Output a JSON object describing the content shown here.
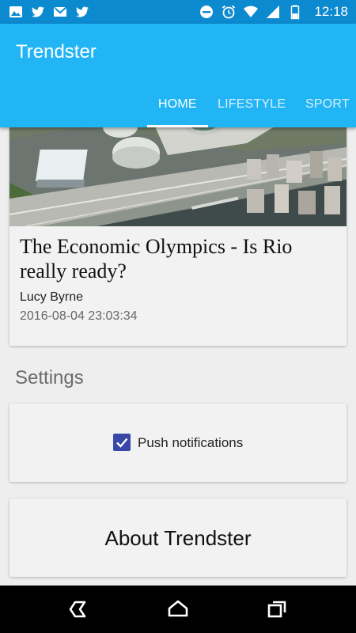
{
  "status_bar": {
    "time": "12:18",
    "left_icons": [
      "image-icon",
      "twitter-icon",
      "gmail-icon",
      "twitter-icon"
    ],
    "right_icons": [
      "do-not-disturb-icon",
      "alarm-icon",
      "wifi-icon",
      "signal-icon",
      "battery-icon"
    ]
  },
  "app_bar": {
    "title": "Trendster",
    "color": "#22b5f5",
    "tabs": [
      {
        "label": "HOME",
        "active": true
      },
      {
        "label": "LIFESTYLE",
        "active": false
      },
      {
        "label": "SPORT",
        "active": false
      }
    ]
  },
  "article": {
    "title": "The Economic Olympics - Is Rio really ready?",
    "author": "Lucy Byrne",
    "date": "2016-08-04 23:03:34",
    "image": "rio-olympic-park-aerial-photo"
  },
  "settings": {
    "heading": "Settings",
    "push_notifications": {
      "label": "Push notifications",
      "checked": true
    },
    "about_label": "About Trendster"
  },
  "nav_bar": {
    "icons": [
      "back-icon",
      "home-icon",
      "recents-icon"
    ]
  }
}
